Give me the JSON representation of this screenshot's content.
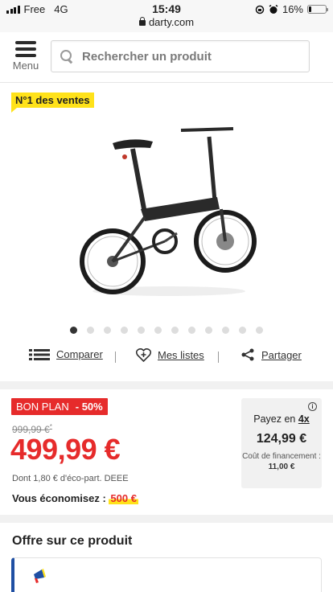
{
  "status_bar": {
    "carrier": "Free",
    "network": "4G",
    "time": "15:49",
    "url": "darty.com",
    "battery": "16%",
    "battery_level": 0.16
  },
  "header": {
    "menu_label": "Menu",
    "search_placeholder": "Rechercher un produit"
  },
  "product": {
    "badge": "N°1 des ventes",
    "image_icon": "folding-electric-bike-image",
    "carousel": {
      "count": 12,
      "active": 0
    }
  },
  "actions": {
    "compare": "Comparer",
    "lists": "Mes listes",
    "share": "Partager"
  },
  "pricing": {
    "deal_label": "BON PLAN",
    "discount": "- 50%",
    "old_price": "999,99 €",
    "old_price_mark": "*",
    "price": "499,99 €",
    "eco_part": "Dont 1,80 € d'éco-part. DEEE",
    "savings_label": "Vous économisez :",
    "savings_amount": "500 €"
  },
  "financing": {
    "label": "Payez en",
    "installments": "4x",
    "amount": "124,99 €",
    "cost_label": "Coût de financement :",
    "cost_value": "11,00 €"
  },
  "offer": {
    "title": "Offre sur ce produit"
  },
  "colors": {
    "brand_red": "#e62b2b",
    "highlight_yellow": "#ffe21a",
    "offer_blue": "#1f4fa3"
  }
}
